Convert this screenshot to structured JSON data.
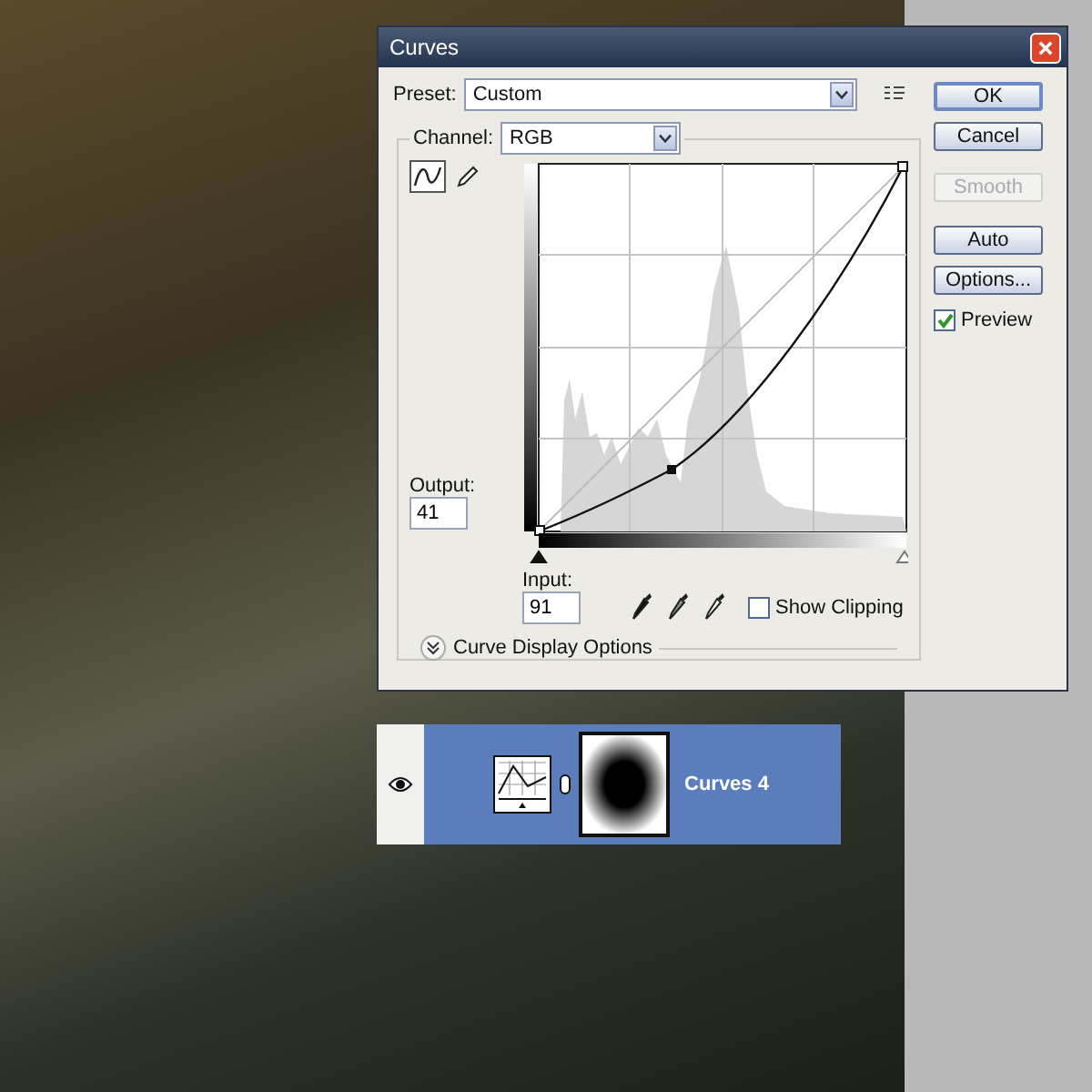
{
  "dialog": {
    "title": "Curves",
    "preset": {
      "label": "Preset:",
      "value": "Custom"
    },
    "channel": {
      "label": "Channel:",
      "value": "RGB"
    },
    "curve_tools": [
      {
        "kind": "curve",
        "selected": true
      },
      {
        "kind": "pencil",
        "selected": false
      }
    ],
    "output": {
      "label": "Output:",
      "value": "41"
    },
    "input": {
      "label": "Input:",
      "value": "91"
    },
    "input_sliders": [
      {
        "level": 0
      },
      {
        "level": 1
      }
    ],
    "show_clipping": {
      "label": "Show Clipping",
      "checked": false
    },
    "display_options": {
      "label": "Curve Display Options",
      "expanded": false
    },
    "buttons": [
      {
        "label": "OK",
        "disabled": false,
        "default": true
      },
      {
        "label": "Cancel",
        "disabled": false,
        "default": false
      },
      {
        "label": "Smooth",
        "disabled": true,
        "default": false
      },
      {
        "label": "Auto",
        "disabled": false,
        "default": false
      },
      {
        "label": "Options...",
        "disabled": false,
        "default": false
      }
    ],
    "preview": {
      "label": "Preview",
      "checked": true
    }
  },
  "layer": {
    "name": "Curves 4",
    "visible": true,
    "selected": true
  }
}
